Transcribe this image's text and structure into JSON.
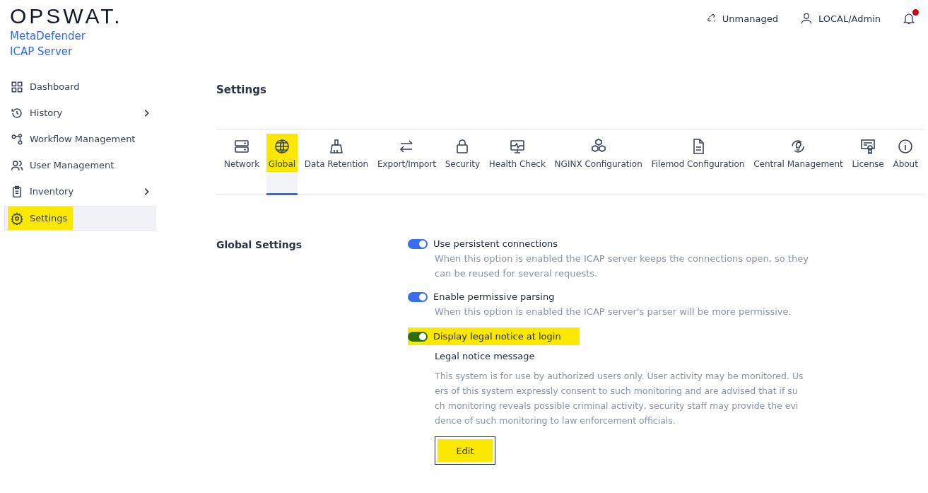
{
  "brand": {
    "logo": "OPSWAT.",
    "product_line1": "MetaDefender",
    "product_line2": "ICAP Server"
  },
  "header": {
    "managed_status": "Unmanaged",
    "user": "LOCAL/Admin",
    "notification_dot": true
  },
  "sidebar": {
    "items": [
      {
        "label": "Dashboard",
        "selected": false,
        "highlighted": false,
        "has_submenu": false
      },
      {
        "label": "History",
        "selected": false,
        "highlighted": false,
        "has_submenu": true
      },
      {
        "label": "Workflow Management",
        "selected": false,
        "highlighted": false,
        "has_submenu": false
      },
      {
        "label": "User Management",
        "selected": false,
        "highlighted": false,
        "has_submenu": false
      },
      {
        "label": "Inventory",
        "selected": false,
        "highlighted": false,
        "has_submenu": true
      },
      {
        "label": "Settings",
        "selected": true,
        "highlighted": true,
        "has_submenu": false
      }
    ]
  },
  "page_title": "Settings",
  "tabs": [
    {
      "label": "Network",
      "selected": false,
      "highlighted": false
    },
    {
      "label": "Global",
      "selected": true,
      "highlighted": true
    },
    {
      "label": "Data Retention",
      "selected": false,
      "highlighted": false
    },
    {
      "label": "Export/Import",
      "selected": false,
      "highlighted": false
    },
    {
      "label": "Security",
      "selected": false,
      "highlighted": false
    },
    {
      "label": "Health Check",
      "selected": false,
      "highlighted": false
    },
    {
      "label": "NGINX Configuration",
      "selected": false,
      "highlighted": false
    },
    {
      "label": "Filemod Configuration",
      "selected": false,
      "highlighted": false
    },
    {
      "label": "Central Management",
      "selected": false,
      "highlighted": false
    },
    {
      "label": "License",
      "selected": false,
      "highlighted": false
    },
    {
      "label": "About",
      "selected": false,
      "highlighted": false
    }
  ],
  "section_title": "Global Settings",
  "options": [
    {
      "label": "Use persistent connections",
      "on": true,
      "highlighted": false,
      "description_lines": [
        "When this option is enabled the ICAP server keeps the connections open, so they",
        "can be reused for several requests."
      ]
    },
    {
      "label": "Enable permissive parsing",
      "on": true,
      "highlighted": false,
      "description_lines": [
        "When this option is enabled the ICAP server's parser will be more permissive."
      ]
    },
    {
      "label": "Display legal notice at login",
      "on": true,
      "highlighted": true
    }
  ],
  "legal_notice": {
    "title": "Legal notice message",
    "lines": [
      "This system is for use by authorized users only. User activity may be monitored. Us",
      "ers of this system expressly consent to such monitoring and are advised that if su",
      "ch monitoring reveals possible criminal activity, security staff may provide the evi",
      "dence of such monitoring to law enforcement officials."
    ],
    "edit_button": {
      "label": "Edit",
      "highlighted": true
    }
  }
}
